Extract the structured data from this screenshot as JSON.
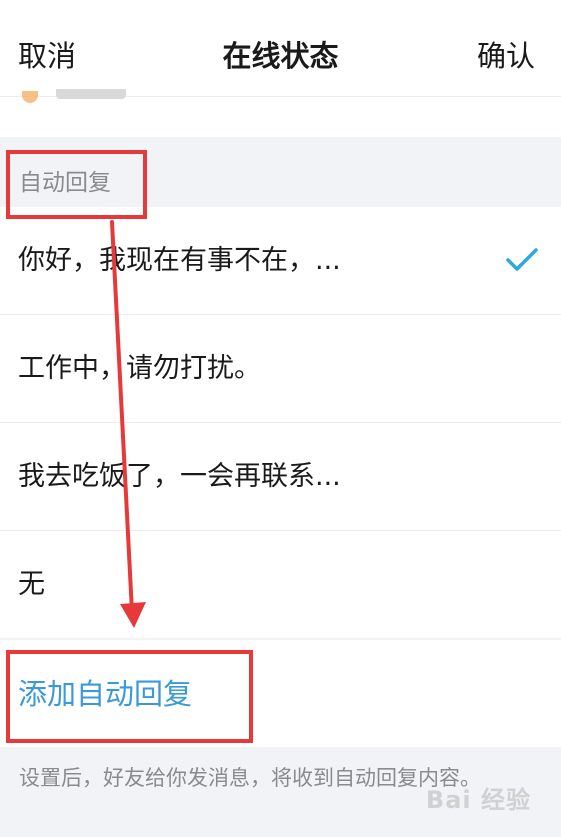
{
  "header": {
    "cancel_label": "取消",
    "title": "在线状态",
    "confirm_label": "确认"
  },
  "section": {
    "label": "自动回复"
  },
  "replies": [
    {
      "text": "你好，我现在有事不在，...",
      "selected": true
    },
    {
      "text": "工作中，请勿打扰。",
      "selected": false
    },
    {
      "text": "我去吃饭了，一会再联系...",
      "selected": false
    },
    {
      "text": "无",
      "selected": false
    }
  ],
  "add_reply": {
    "label": "添加自动回复"
  },
  "hint": {
    "text": "设置后，好友给你发消息，将收到自动回复内容。"
  },
  "watermark": {
    "text": "Bai 经验"
  },
  "colors": {
    "accent": "#3a9ad9",
    "check": "#2aa8e0",
    "annotation": "#e63a3a"
  }
}
